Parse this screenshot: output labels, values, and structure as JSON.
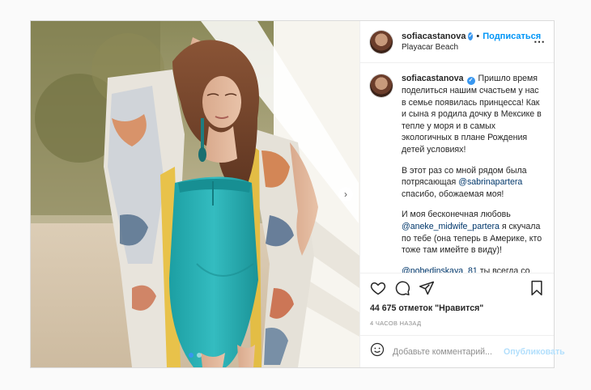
{
  "post": {
    "username": "sofiacastanova",
    "verified_mark": "✓",
    "follow_separator": "•",
    "follow_label": "Подписаться",
    "location": "Playacar Beach",
    "more_glyph": "⋯"
  },
  "photo": {
    "next_glyph": "›",
    "carousel_total": 2,
    "carousel_active": 1,
    "accent_color": "#3897f0"
  },
  "caption": {
    "username": "sofiacastanova",
    "paragraph1": "Пришло время поделиться нашим счастьем у нас в семье появилась принцесса! Как и сына я родила дочку в Мексике в тепле у моря и в самых экологичных в плане Рождения детей условиях!",
    "paragraph2_before": "В этот раз со мной рядом была потрясающая ",
    "paragraph2_mention": "@sabrinapartera",
    "paragraph2_after": " спасибо, обожаемая моя!",
    "paragraph3_before": "И моя бесконечная любовь ",
    "paragraph3_mention": "@aneke_midwife_partera",
    "paragraph3_after": " я скучала по тебе (она теперь в Америке, кто тоже там имейте в виду)!",
    "paragraph4_mention": "@pobedinskaya_81",
    "paragraph4_after": " ты всегда со мной на связи, несмотря на часовые полюса, спасибо мой любимый доктоо!"
  },
  "actions": {
    "icons": [
      "heart-icon",
      "comment-icon",
      "share-icon",
      "bookmark-icon"
    ],
    "likes_text": "44 675 отметок \"Нравится\"",
    "timestamp": "4 ЧАСОВ НАЗАД"
  },
  "comment_box": {
    "emoji_icon": "smile-icon",
    "placeholder": "Добавьте комментарий...",
    "publish_label": "Опубликовать",
    "publish_color": "#b2dffc"
  },
  "colors": {
    "link": "#0095f6",
    "mention": "#00376b",
    "border": "#dbdbdb"
  }
}
